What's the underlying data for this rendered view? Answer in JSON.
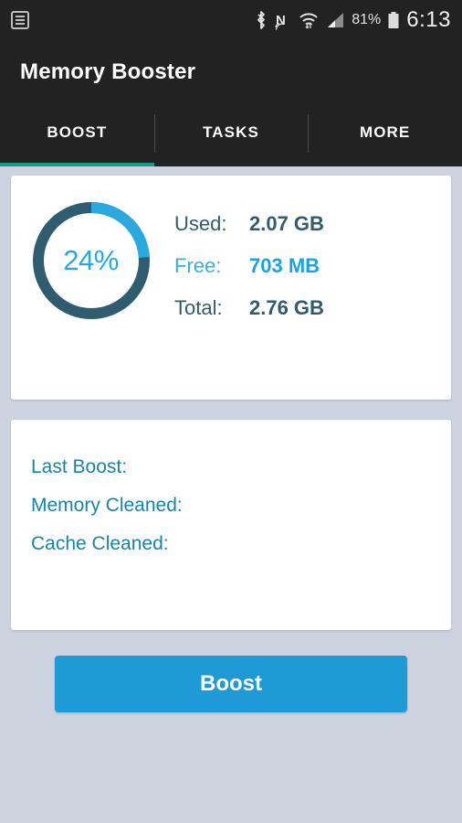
{
  "status_bar": {
    "left_icon": "notifications-list-icon",
    "icons": [
      "bluetooth-icon",
      "nfc-icon",
      "wifi-icon",
      "cellular-signal-icon"
    ],
    "battery_percent": "81%",
    "battery_icon": "battery-icon",
    "time": "6:13"
  },
  "app": {
    "title": "Memory Booster"
  },
  "tabs": [
    {
      "label": "BOOST",
      "active": true
    },
    {
      "label": "TASKS",
      "active": false
    },
    {
      "label": "MORE",
      "active": false
    }
  ],
  "memory_card": {
    "percent_label": "24%",
    "percent_value": 24,
    "stats": [
      {
        "label": "Used:",
        "value": "2.07 GB",
        "highlight": false
      },
      {
        "label": "Free:",
        "value": "703 MB",
        "highlight": true
      },
      {
        "label": "Total:",
        "value": "2.76 GB",
        "highlight": false
      }
    ]
  },
  "history_card": {
    "lines": [
      "Last Boost:",
      "Memory Cleaned:",
      "Cache Cleaned:"
    ]
  },
  "actions": {
    "boost_label": "Boost"
  },
  "colors": {
    "accent_blue": "#29a9e0",
    "button_blue": "#1e9ad6",
    "dark_teal": "#2f5c6e",
    "tab_indicator": "#159b86",
    "bar_background": "#222222",
    "page_background": "#cdd3de"
  }
}
